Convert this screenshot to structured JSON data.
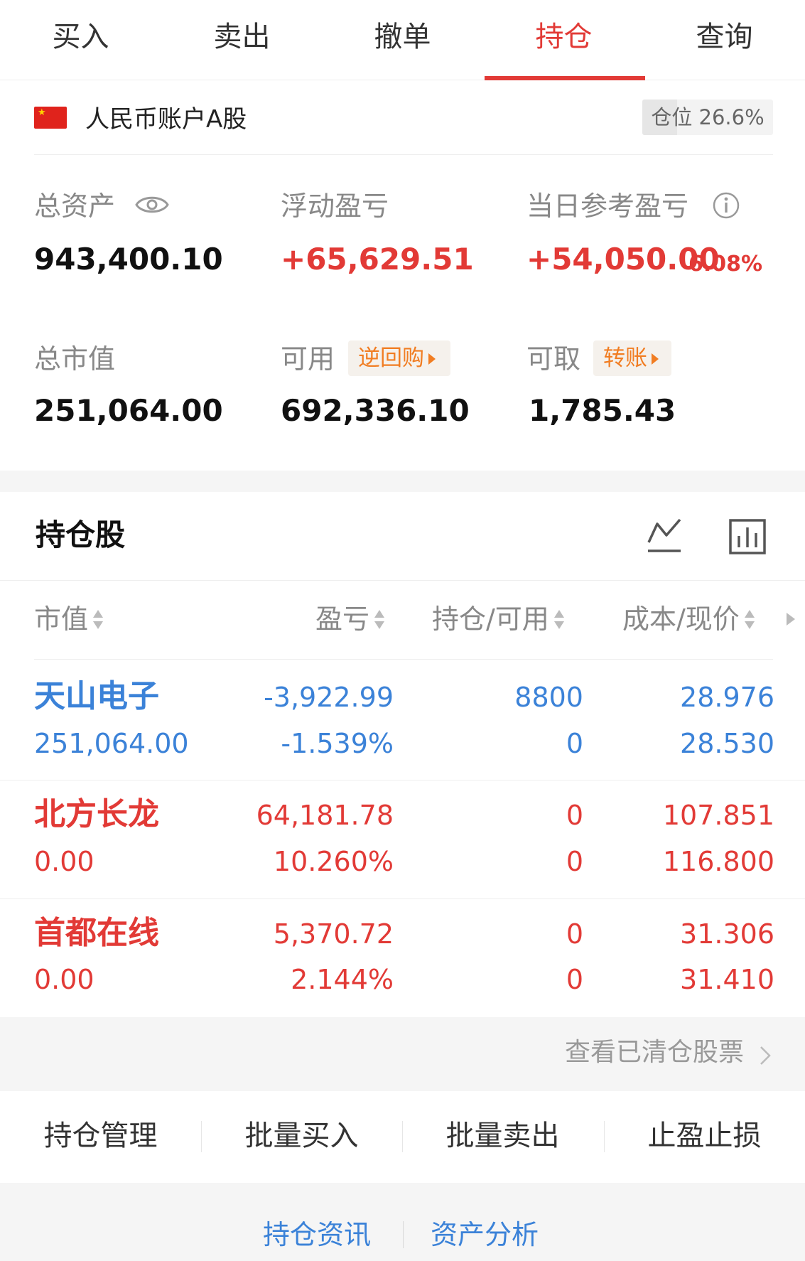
{
  "tabs": [
    {
      "label": "买入"
    },
    {
      "label": "卖出"
    },
    {
      "label": "撤单"
    },
    {
      "label": "持仓",
      "active": true
    },
    {
      "label": "查询"
    }
  ],
  "account": {
    "flag_icon": "china-flag-icon",
    "name": "人民币账户A股",
    "position_label": "仓位 26.6%",
    "position_ratio": 0.266
  },
  "summary": {
    "total_assets_label": "总资产",
    "total_assets": "943,400.10",
    "floating_pl_label": "浮动盈亏",
    "floating_pl": "+65,629.51",
    "daily_pl_label": "当日参考盈亏",
    "daily_pl": "+54,050.00",
    "daily_pl_pct": "6.08%",
    "market_value_label": "总市值",
    "market_value": "251,064.00",
    "available_label": "可用",
    "available": "692,336.10",
    "reverse_repo_label": "逆回购",
    "withdrawable_label": "可取",
    "withdrawable": "1,785.43",
    "transfer_label": "转账"
  },
  "holdings": {
    "title": "持仓股",
    "columns": [
      "市值",
      "盈亏",
      "持仓/可用",
      "成本/现价"
    ],
    "rows": [
      {
        "name": "天山电子",
        "market_value": "251,064.00",
        "pl": "-3,922.99",
        "pl_pct": "-1.539%",
        "position": "8800",
        "available": "0",
        "cost": "28.976",
        "price": "28.530",
        "color": "#3b82d8"
      },
      {
        "name": "北方长龙",
        "market_value": "0.00",
        "pl": "64,181.78",
        "pl_pct": "10.260%",
        "position": "0",
        "available": "0",
        "cost": "107.851",
        "price": "116.800",
        "color": "#e23a36"
      },
      {
        "name": "首都在线",
        "market_value": "0.00",
        "pl": "5,370.72",
        "pl_pct": "2.144%",
        "position": "0",
        "available": "0",
        "cost": "31.306",
        "price": "31.410",
        "color": "#e23a36"
      }
    ],
    "view_cleared": "查看已清仓股票"
  },
  "actions": [
    "持仓管理",
    "批量买入",
    "批量卖出",
    "止盈止损"
  ],
  "links": [
    "持仓资讯",
    "资产分析"
  ],
  "colors": {
    "accent": "#e23a36",
    "link": "#3b82d8",
    "orange": "#f17d22"
  }
}
